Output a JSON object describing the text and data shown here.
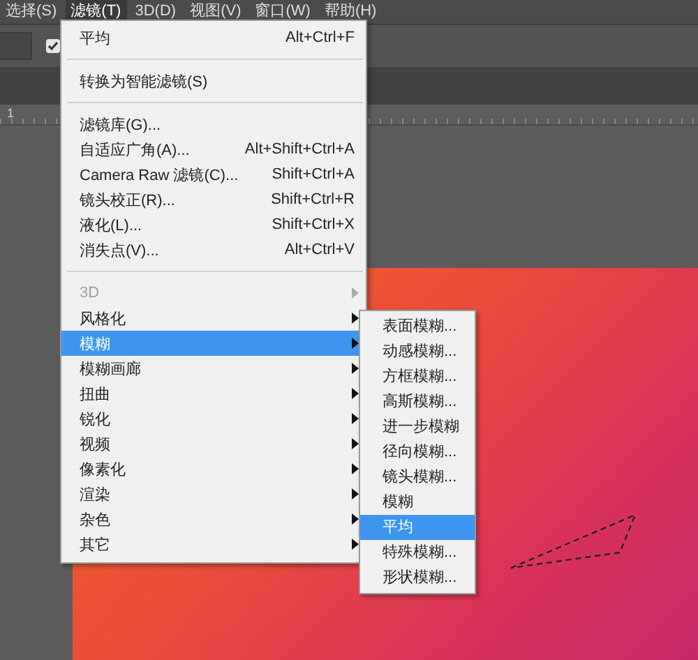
{
  "menubar": [
    {
      "label": "选择(S)",
      "selected": false
    },
    {
      "label": "滤镜(T)",
      "selected": true
    },
    {
      "label": "3D(D)",
      "selected": false
    },
    {
      "label": "视图(V)",
      "selected": false
    },
    {
      "label": "窗口(W)",
      "selected": false
    },
    {
      "label": "帮助(H)",
      "selected": false
    }
  ],
  "options_bar": {
    "checkbox": {
      "checked": true
    }
  },
  "ruler": {
    "label": "1"
  },
  "filter_menu": {
    "items": [
      {
        "kind": "item",
        "label": "平均",
        "shortcut": "Alt+Ctrl+F",
        "disabled": false,
        "has_submenu": false,
        "selected": false
      },
      {
        "kind": "separator"
      },
      {
        "kind": "item",
        "label": "转换为智能滤镜(S)",
        "disabled": false,
        "has_submenu": false,
        "selected": false
      },
      {
        "kind": "separator"
      },
      {
        "kind": "item",
        "label": "滤镜库(G)...",
        "disabled": false,
        "has_submenu": false,
        "selected": false
      },
      {
        "kind": "item",
        "label": "自适应广角(A)...",
        "shortcut": "Alt+Shift+Ctrl+A",
        "disabled": false,
        "has_submenu": false,
        "selected": false
      },
      {
        "kind": "item",
        "label": "Camera Raw 滤镜(C)...",
        "shortcut": "Shift+Ctrl+A",
        "disabled": false,
        "has_submenu": false,
        "selected": false
      },
      {
        "kind": "item",
        "label": "镜头校正(R)...",
        "shortcut": "Shift+Ctrl+R",
        "disabled": false,
        "has_submenu": false,
        "selected": false
      },
      {
        "kind": "item",
        "label": "液化(L)...",
        "shortcut": "Shift+Ctrl+X",
        "disabled": false,
        "has_submenu": false,
        "selected": false
      },
      {
        "kind": "item",
        "label": "消失点(V)...",
        "shortcut": "Alt+Ctrl+V",
        "disabled": false,
        "has_submenu": false,
        "selected": false
      },
      {
        "kind": "separator"
      },
      {
        "kind": "item",
        "label": "3D",
        "disabled": true,
        "has_submenu": true,
        "selected": false
      },
      {
        "kind": "item",
        "label": "风格化",
        "disabled": false,
        "has_submenu": true,
        "selected": false
      },
      {
        "kind": "item",
        "label": "模糊",
        "disabled": false,
        "has_submenu": true,
        "selected": true
      },
      {
        "kind": "item",
        "label": "模糊画廊",
        "disabled": false,
        "has_submenu": true,
        "selected": false
      },
      {
        "kind": "item",
        "label": "扭曲",
        "disabled": false,
        "has_submenu": true,
        "selected": false
      },
      {
        "kind": "item",
        "label": "锐化",
        "disabled": false,
        "has_submenu": true,
        "selected": false
      },
      {
        "kind": "item",
        "label": "视频",
        "disabled": false,
        "has_submenu": true,
        "selected": false
      },
      {
        "kind": "item",
        "label": "像素化",
        "disabled": false,
        "has_submenu": true,
        "selected": false
      },
      {
        "kind": "item",
        "label": "渲染",
        "disabled": false,
        "has_submenu": true,
        "selected": false
      },
      {
        "kind": "item",
        "label": "杂色",
        "disabled": false,
        "has_submenu": true,
        "selected": false
      },
      {
        "kind": "item",
        "label": "其它",
        "disabled": false,
        "has_submenu": true,
        "selected": false
      }
    ]
  },
  "blur_submenu": {
    "items": [
      {
        "label": "表面模糊...",
        "selected": false
      },
      {
        "label": "动感模糊...",
        "selected": false
      },
      {
        "label": "方框模糊...",
        "selected": false
      },
      {
        "label": "高斯模糊...",
        "selected": false
      },
      {
        "label": "进一步模糊",
        "selected": false
      },
      {
        "label": "径向模糊...",
        "selected": false
      },
      {
        "label": "镜头模糊...",
        "selected": false
      },
      {
        "label": "模糊",
        "selected": false
      },
      {
        "label": "平均",
        "selected": true
      },
      {
        "label": "特殊模糊...",
        "selected": false
      },
      {
        "label": "形状模糊...",
        "selected": false
      }
    ]
  }
}
